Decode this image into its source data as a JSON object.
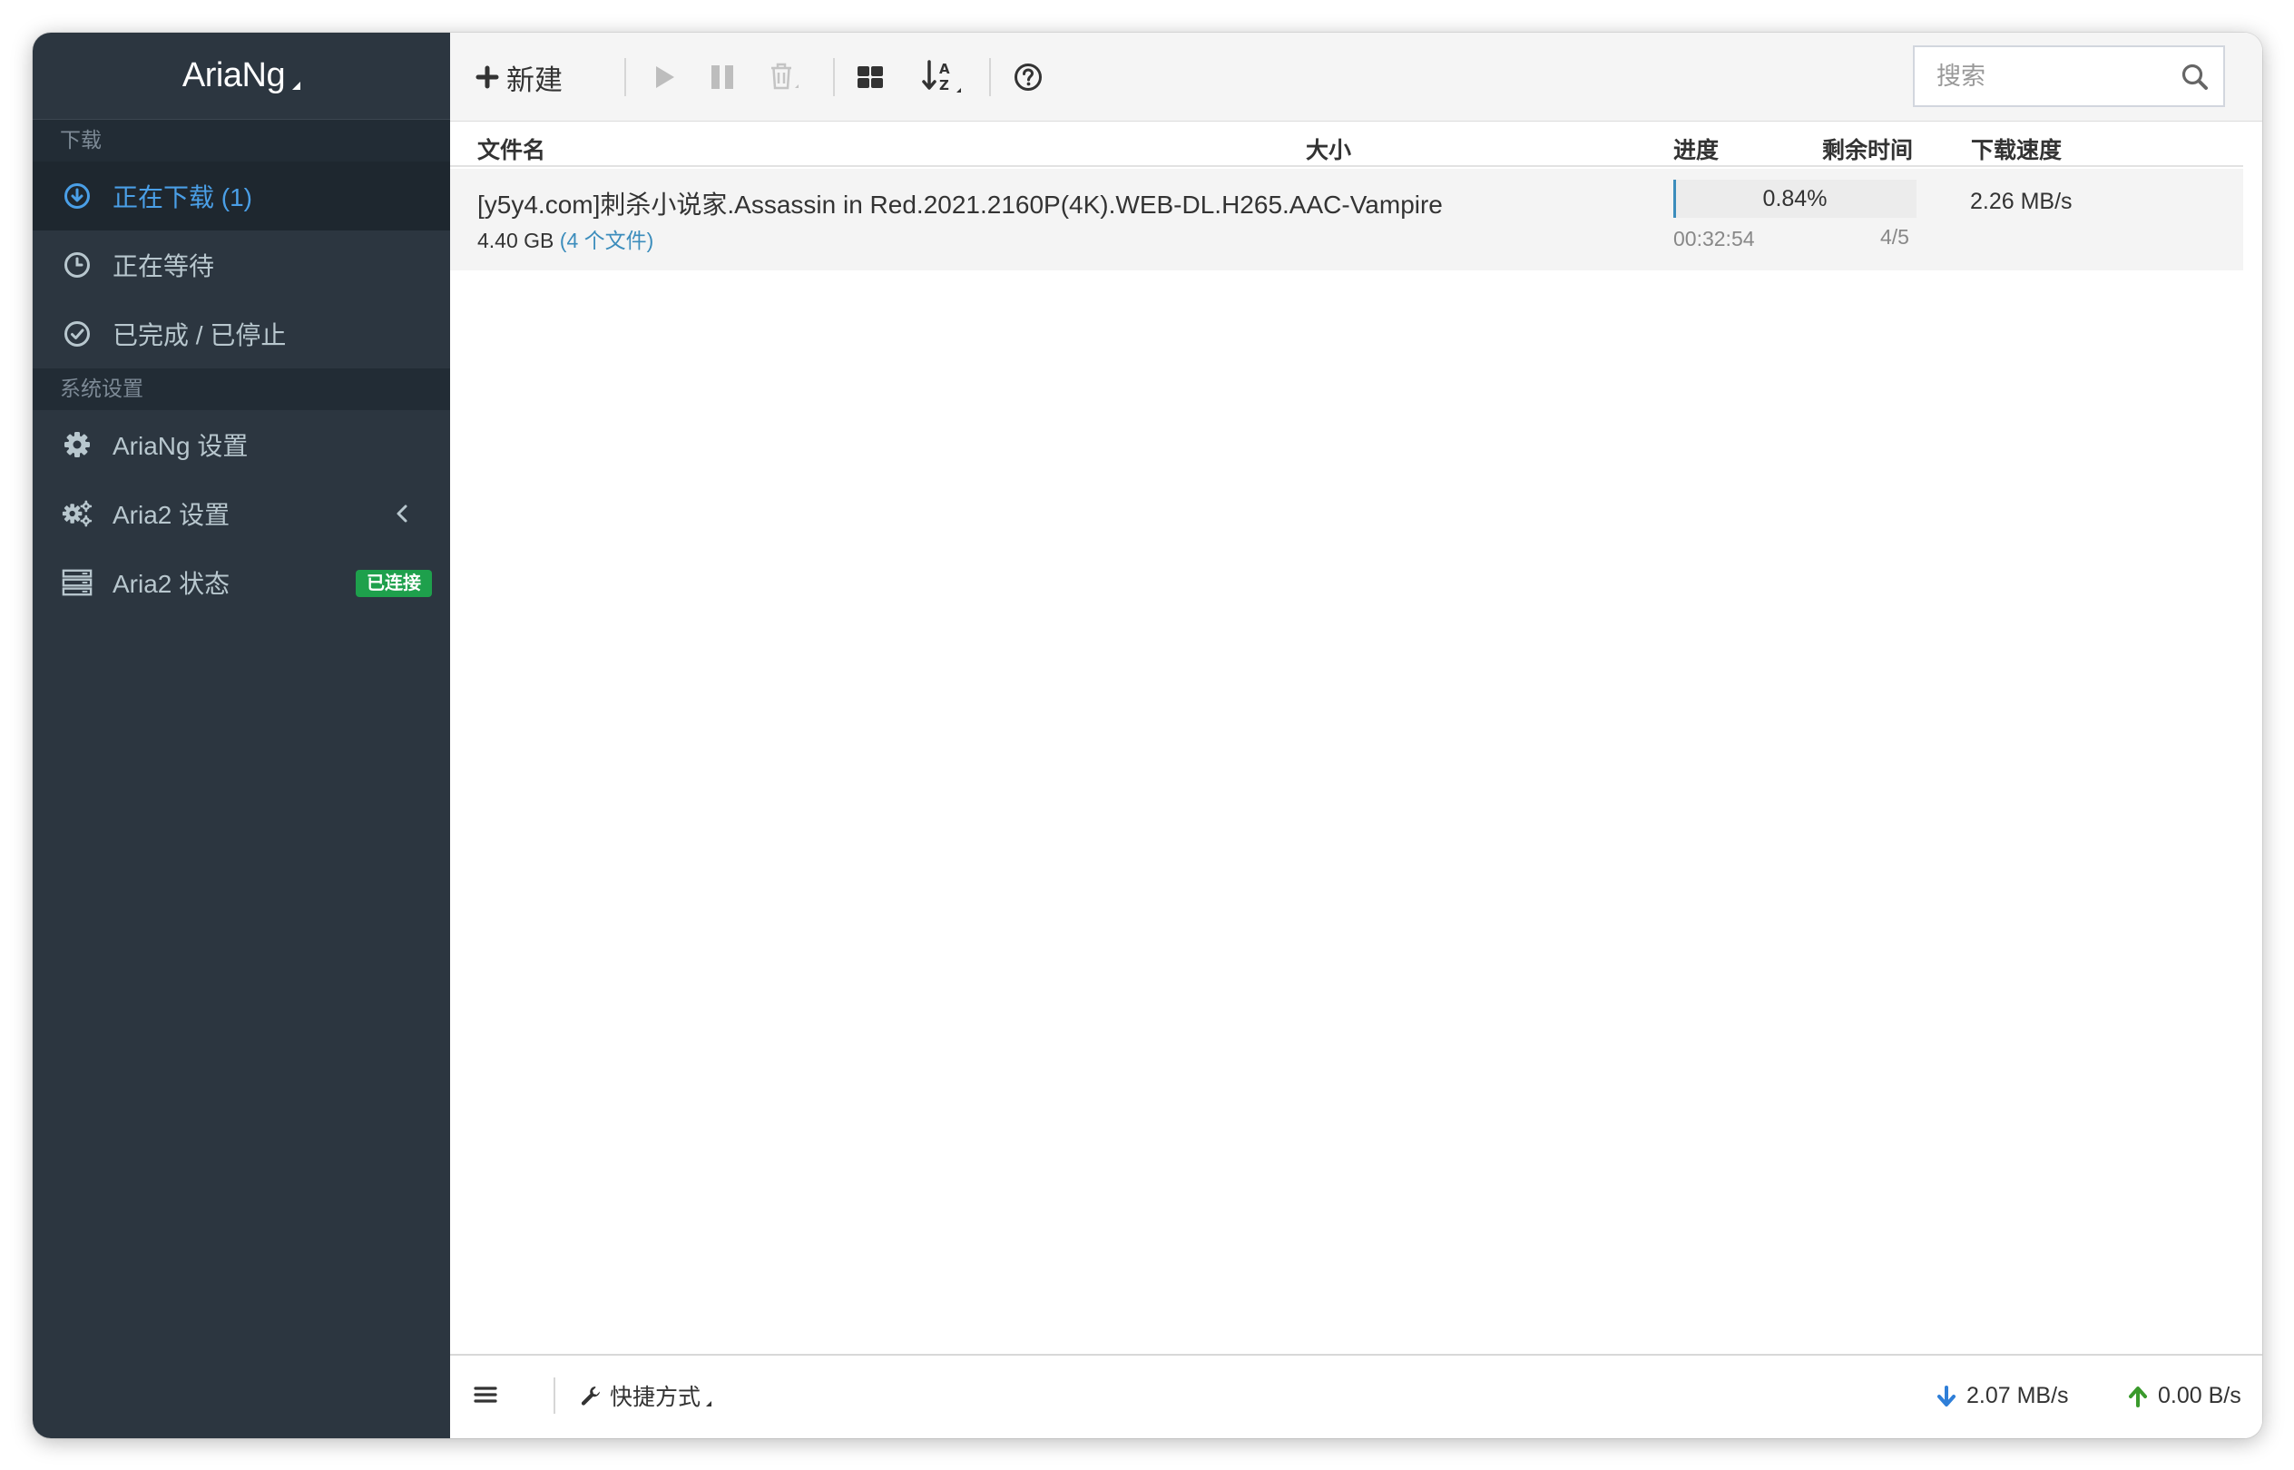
{
  "app": {
    "title": "AriaNg"
  },
  "sidebar": {
    "sections": [
      {
        "header": "下载"
      },
      {
        "header": "系统设置"
      }
    ],
    "items": [
      {
        "label": "正在下载 (1)",
        "icon": "download-circle-icon",
        "active": true
      },
      {
        "label": "正在等待",
        "icon": "clock-icon"
      },
      {
        "label": "已完成 / 已停止",
        "icon": "check-circle-icon"
      },
      {
        "label": "AriaNg 设置",
        "icon": "gear-icon"
      },
      {
        "label": "Aria2 设置",
        "icon": "gears-icon"
      },
      {
        "label": "Aria2 状态",
        "icon": "server-icon",
        "badge": "已连接",
        "badge_color": "#1ea04c"
      }
    ]
  },
  "toolbar": {
    "new_label": "新建",
    "search_placeholder": "搜索"
  },
  "table": {
    "headers": {
      "name": "文件名",
      "size": "大小",
      "progress": "进度",
      "remaining": "剩余时间",
      "speed": "下载速度"
    },
    "tasks": [
      {
        "name": "[y5y4.com]刺杀小说家.Assassin in Red.2021.2160P(4K).WEB-DL.H265.AAC-Vampire",
        "size": "4.40 GB",
        "files": "(4 个文件)",
        "progress_text": "0.84%",
        "progress_value": 0.0084,
        "remaining": "00:32:54",
        "connections": "4/5",
        "speed": "2.26 MB/s"
      }
    ]
  },
  "footer": {
    "shortcut_label": "快捷方式",
    "download_speed": "2.07 MB/s",
    "upload_speed": "0.00 B/s"
  },
  "colors": {
    "sidebar_bg": "#2c3640",
    "accent": "#3c8dbc",
    "active_text": "#4a9fe7",
    "download_arrow": "#2f7fd8",
    "upload_arrow": "#3a9a2c"
  }
}
